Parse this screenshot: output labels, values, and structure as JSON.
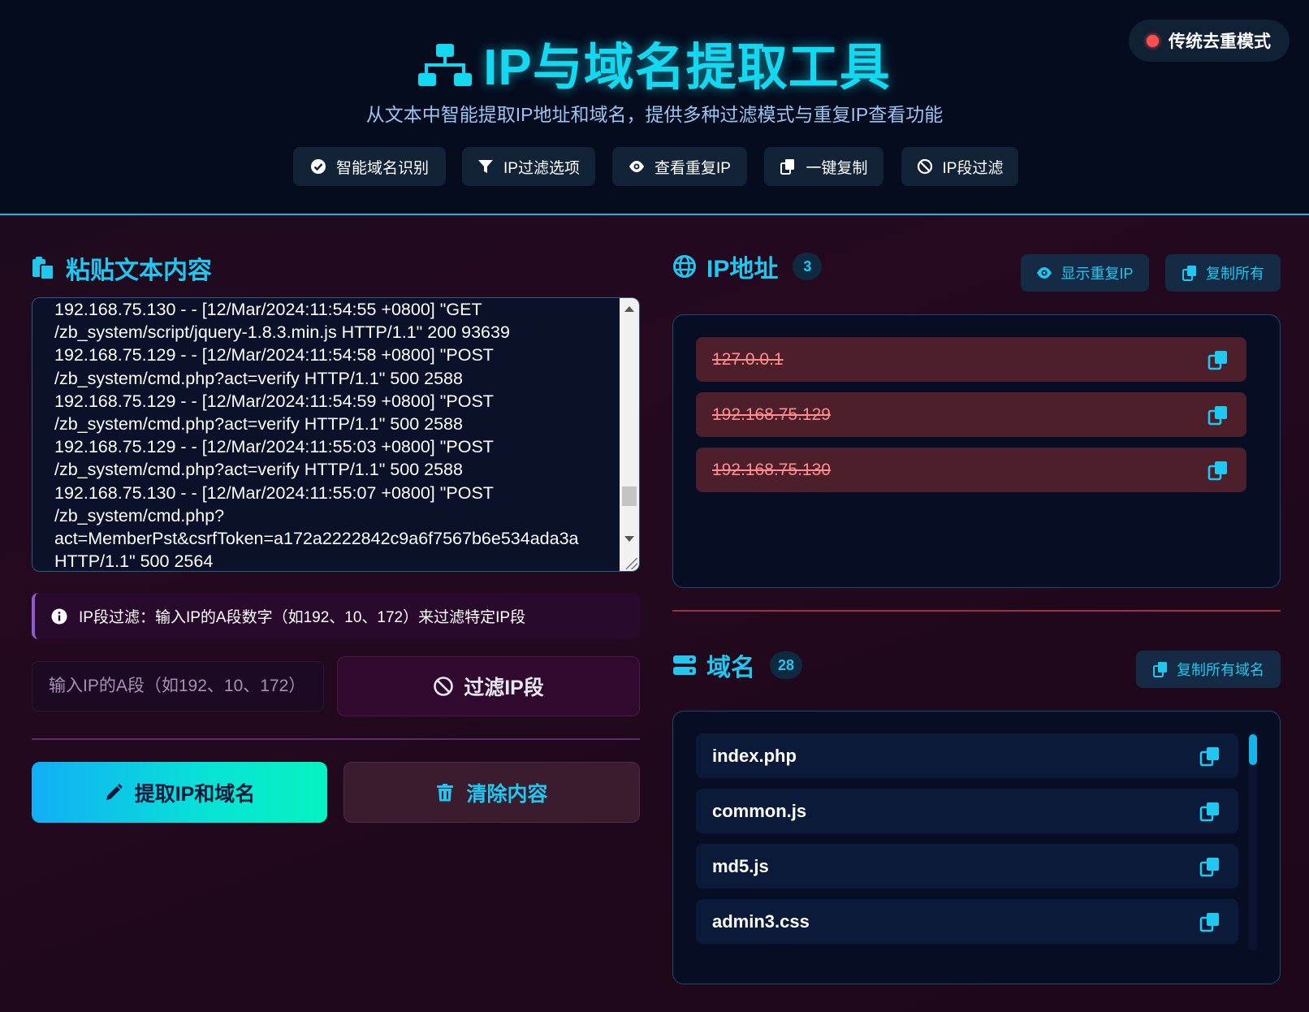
{
  "header": {
    "title": "IP与域名提取工具",
    "subtitle": "从文本中智能提取IP地址和域名，提供多种过滤模式与重复IP查看功能",
    "mode_badge": "传统去重模式",
    "features": [
      {
        "icon": "check-circle-icon",
        "label": "智能域名识别"
      },
      {
        "icon": "filter-icon",
        "label": "IP过滤选项"
      },
      {
        "icon": "eye-icon",
        "label": "查看重复IP"
      },
      {
        "icon": "copy-icon",
        "label": "一键复制"
      },
      {
        "icon": "ban-icon",
        "label": "IP段过滤"
      }
    ]
  },
  "left": {
    "section_title": "粘贴文本内容",
    "textarea_lines": [
      "192.168.75.130 - - [12/Mar/2024:11:54:55 +0800] \"GET",
      "/zb_system/script/jquery-1.8.3.min.js HTTP/1.1\" 200 93639",
      "192.168.75.129 - - [12/Mar/2024:11:54:58 +0800] \"POST",
      "/zb_system/cmd.php?act=verify HTTP/1.1\" 500 2588",
      "192.168.75.129 - - [12/Mar/2024:11:54:59 +0800] \"POST",
      "/zb_system/cmd.php?act=verify HTTP/1.1\" 500 2588",
      "192.168.75.129 - - [12/Mar/2024:11:55:03 +0800] \"POST",
      "/zb_system/cmd.php?act=verify HTTP/1.1\" 500 2588",
      "192.168.75.130 - - [12/Mar/2024:11:55:07 +0800] \"POST",
      "/zb_system/cmd.php?",
      "act=MemberPst&csrfToken=a172a2222842c9a6f7567b6e534ada3a",
      "HTTP/1.1\" 500 2564"
    ],
    "info": "IP段过滤：输入IP的A段数字（如192、10、172）来过滤特定IP段",
    "segment_placeholder": "输入IP的A段（如192、10、172）",
    "filter_button": "过滤IP段",
    "extract_button": "提取IP和域名",
    "clear_button": "清除内容"
  },
  "ip_section": {
    "title": "IP地址",
    "count": "3",
    "show_dup_button": "显示重复IP",
    "copy_all_button": "复制所有",
    "items": [
      "127.0.0.1",
      "192.168.75.129",
      "192.168.75.130"
    ]
  },
  "domain_section": {
    "title": "域名",
    "count": "28",
    "copy_all_button": "复制所有域名",
    "items": [
      "index.php",
      "common.js",
      "md5.js",
      "admin3.css"
    ]
  },
  "colors": {
    "accent": "#20c7ef",
    "header_bg": "#050c1e",
    "duplicate_ip_bg": "#4d1f2a",
    "duplicate_ip_text": "#ff8d8d",
    "badge_dot": "#ff4f4f"
  }
}
